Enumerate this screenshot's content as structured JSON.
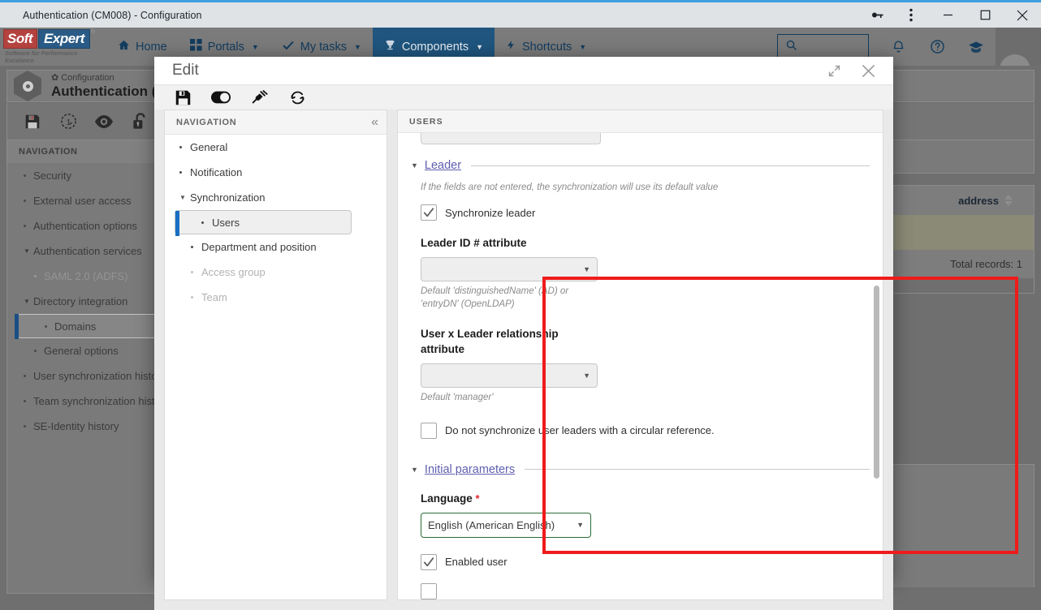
{
  "window": {
    "title": "Authentication (CM008) - Configuration",
    "controls": {
      "key": "key-icon",
      "menu": "kebab-menu-icon",
      "minimize": "–",
      "maximize": "□",
      "close": "✕"
    }
  },
  "app_header": {
    "logo": {
      "soft": "Soft",
      "expert": "Expert",
      "registered": "®",
      "tagline": "Software for Performance Excelance"
    },
    "nav": [
      {
        "label": "Home",
        "icon": "home-icon",
        "has_caret": false,
        "active": false
      },
      {
        "label": "Portals",
        "icon": "grid-icon",
        "has_caret": true,
        "active": false
      },
      {
        "label": "My tasks",
        "icon": "check-icon",
        "has_caret": true,
        "active": false
      },
      {
        "label": "Components",
        "icon": "trophy-icon",
        "has_caret": true,
        "active": true
      },
      {
        "label": "Shortcuts",
        "icon": "bolt-icon",
        "has_caret": true,
        "active": false
      }
    ],
    "search_placeholder": "",
    "right_icons": [
      "bell-icon",
      "help-icon",
      "graduation-cap-icon",
      "avatar"
    ]
  },
  "page": {
    "breadcrumb_small": "Configuration",
    "title": "Authentication (C",
    "toolbar_icons": [
      "save-icon",
      "revision-icon",
      "view-icon",
      "unlock-icon"
    ],
    "nav_header": "NAVIGATION",
    "nav_items": [
      {
        "label": "Security",
        "level": 0,
        "type": "dot"
      },
      {
        "label": "External user access",
        "level": 0,
        "type": "dot"
      },
      {
        "label": "Authentication options",
        "level": 0,
        "type": "dot"
      },
      {
        "label": "Authentication services",
        "level": 0,
        "type": "caret"
      },
      {
        "label": "SAML 2.0 (ADFS)",
        "level": 1,
        "type": "dot",
        "dim": true
      },
      {
        "label": "Directory integration",
        "level": 0,
        "type": "caret"
      },
      {
        "label": "Domains",
        "level": 1,
        "type": "dot",
        "selected": true
      },
      {
        "label": "General options",
        "level": 1,
        "type": "dot"
      },
      {
        "label": "User synchronization history",
        "level": 0,
        "type": "dot"
      },
      {
        "label": "Team synchronization history",
        "level": 0,
        "type": "dot"
      },
      {
        "label": "SE-Identity history",
        "level": 0,
        "type": "dot"
      }
    ],
    "table": {
      "column_header": "address",
      "footer": "Total records: 1"
    }
  },
  "modal": {
    "title": "Edit",
    "expand_icon": "expand-icon",
    "close_icon": "close-icon",
    "toolbar_icons": [
      "save-icon",
      "toggle-icon",
      "test-connection-icon",
      "synchronize-icon"
    ],
    "nav": {
      "header": "NAVIGATION",
      "collapse_icon": "collapse-left-icon",
      "items": [
        {
          "label": "General",
          "level": 0,
          "type": "dot"
        },
        {
          "label": "Notification",
          "level": 0,
          "type": "dot"
        },
        {
          "label": "Synchronization",
          "level": 0,
          "type": "caret"
        },
        {
          "label": "Users",
          "level": 1,
          "type": "dot",
          "selected": true
        },
        {
          "label": "Department and position",
          "level": 1,
          "type": "dot"
        },
        {
          "label": "Access group",
          "level": 1,
          "type": "dot",
          "dim": true
        },
        {
          "label": "Team",
          "level": 1,
          "type": "dot",
          "dim": true
        }
      ]
    },
    "content": {
      "header": "USERS",
      "sections": [
        {
          "title": "Leader",
          "note": "If the fields are not entered, the synchronization will use its default value",
          "checkbox_top": {
            "label": "Synchronize leader",
            "checked": true
          },
          "fields": [
            {
              "label": "Leader ID # attribute",
              "value": "",
              "hint": "Default 'distinguishedName' (AD) or 'entryDN' (OpenLDAP)"
            },
            {
              "label": "User x Leader relationship attribute",
              "value": "",
              "hint": "Default 'manager'"
            }
          ],
          "checkbox_bottom": {
            "label": "Do not synchronize user leaders with a circular reference.",
            "checked": false
          }
        },
        {
          "title": "Initial parameters",
          "language_label": "Language",
          "language_required": "*",
          "language_value": "English (American English)",
          "checkbox_enabled": {
            "label": "Enabled user",
            "checked": true
          }
        }
      ]
    }
  },
  "colors": {
    "highlight_box": "#ef1b1b",
    "accent_blue": "#1a6fc4",
    "link_purple": "#5f5fb0",
    "valid_green": "#2c6b38",
    "required_red": "#e2242c",
    "brand_red": "#b4423f",
    "brand_blue": "#2a5b86"
  }
}
